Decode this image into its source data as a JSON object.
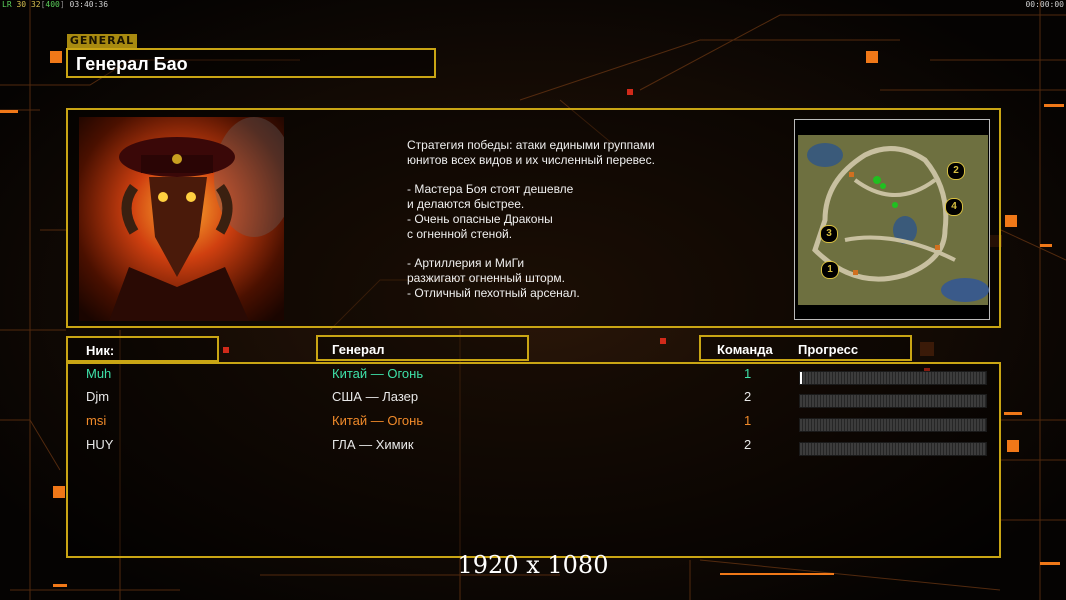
{
  "hud": {
    "fps_prefix": "LR",
    "fps_a": "30",
    "fps_b": "32",
    "fps_c": "400",
    "time_left": "03:40:36",
    "time_right": "00:00:00"
  },
  "header": {
    "tag": "GENERAL",
    "title": "Генерал Бао"
  },
  "description": "Стратегия победы: атаки едиными группами\nюнитов всех видов и их численный перевес.\n\n- Мастера Боя стоят дешевле\nи делаются быстрее.\n- Очень опасные Драконы\nс огненной стеной.\n\n- Артиллерия и МиГи\nразжигают огненный шторм.\n- Отличный пехотный арсенал.",
  "map": {
    "start_positions": [
      "1",
      "2",
      "3",
      "4"
    ]
  },
  "columns": {
    "nick": "Ник:",
    "general": "Генерал",
    "team": "Команда",
    "progress": "Прогресс"
  },
  "players": [
    {
      "nick": "Muh",
      "general": "Китай — Огонь",
      "team": "1",
      "color": "#3ee0a8",
      "progress": 0.01
    },
    {
      "nick": "Djm",
      "general": "США — Лазер",
      "team": "2",
      "color": "#e8e8e8",
      "progress": 0.0
    },
    {
      "nick": "msi",
      "general": "Китай — Огонь",
      "team": "1",
      "color": "#f08a2a",
      "progress": 0.0
    },
    {
      "nick": "HUY",
      "general": "ГЛА — Химик",
      "team": "2",
      "color": "#e8e8e8",
      "progress": 0.0
    }
  ],
  "resolution": "1920 x 1080",
  "colors": {
    "accent": "#c9a514",
    "orange": "#f07818"
  }
}
